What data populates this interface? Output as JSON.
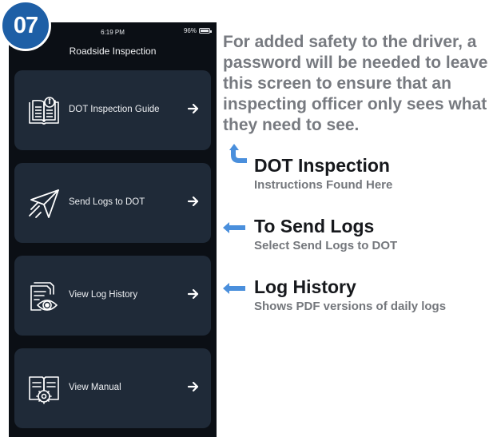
{
  "step_badge": "07",
  "status_bar": {
    "time": "6:19 PM",
    "battery": "96%"
  },
  "screen_title": "Roadside Inspection",
  "menu": [
    {
      "label": "DOT Inspection Guide",
      "icon": "inspection-guide-book-icon"
    },
    {
      "label": "Send Logs to DOT",
      "icon": "paper-plane-send-icon"
    },
    {
      "label": "View Log History",
      "icon": "document-eye-history-icon"
    },
    {
      "label": "View Manual",
      "icon": "manual-gear-book-icon"
    }
  ],
  "intro_text": "For added safety to the driver, a password will be needed to leave this screen to ensure that an inspecting officer only sees what they need to see.",
  "callouts": [
    {
      "title": "DOT Inspection",
      "subtitle": "Instructions Found Here"
    },
    {
      "title": "To Send Logs",
      "subtitle": "Select Send Logs to DOT"
    },
    {
      "title": "Log History",
      "subtitle": "Shows PDF versions of daily logs"
    }
  ],
  "colors": {
    "badge": "#1e5fa6",
    "arrow": "#4a8fdc",
    "screen_bg": "#0b0f15",
    "card_bg": "#1f2a38"
  }
}
